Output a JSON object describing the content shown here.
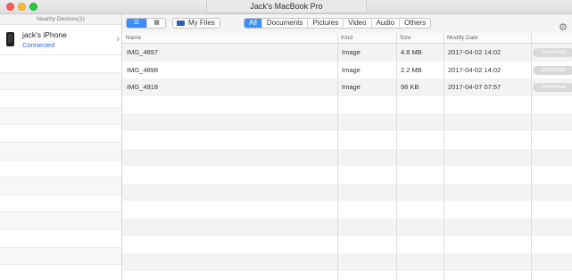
{
  "window": {
    "title": "Jack's MacBook Pro"
  },
  "sidebar": {
    "header": "Nearby Devices(1)",
    "devices": [
      {
        "name": "jack's iPhone",
        "status": "Connected",
        "icon": "iphone-icon"
      }
    ]
  },
  "toolbar": {
    "view_list_icon": "list-view-icon",
    "view_grid_icon": "grid-view-icon",
    "my_files_label": "My Files",
    "filters": [
      "All",
      "Documents",
      "Pictures",
      "Video",
      "Audio",
      "Others"
    ],
    "active_filter": "All"
  },
  "table": {
    "columns": [
      "Name",
      "Kind",
      "Size",
      "Modify Date"
    ],
    "rows": [
      {
        "name": "IMG_4897",
        "kind": "Image",
        "size": "4.8 MB",
        "date": "2017-04-02 14:02",
        "action": "Download"
      },
      {
        "name": "IMG_4898",
        "kind": "Image",
        "size": "2.2 MB",
        "date": "2017-04-02 14:02",
        "action": "Download"
      },
      {
        "name": "IMG_4918",
        "kind": "Image",
        "size": "98 KB",
        "date": "2017-04-07 07:57",
        "action": "Download"
      }
    ]
  },
  "colors": {
    "accent": "#3d8ff5",
    "connected": "#2a67d6"
  }
}
